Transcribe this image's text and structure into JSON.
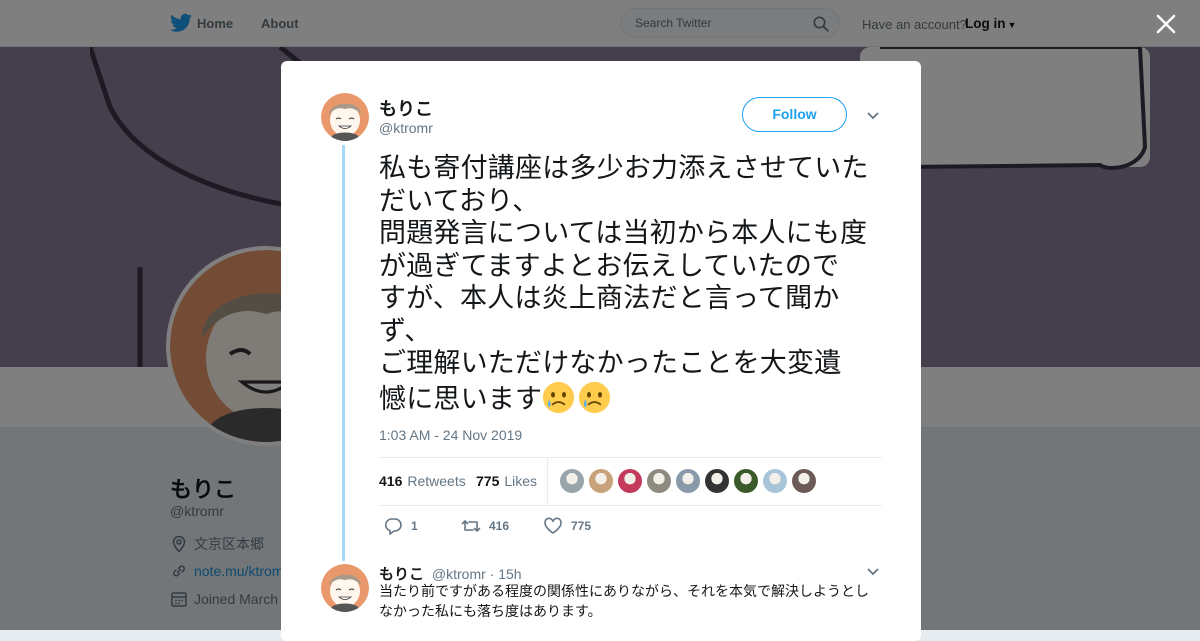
{
  "nav": {
    "home": "Home",
    "about": "About",
    "search_placeholder": "Search Twitter",
    "have_account": "Have an account?",
    "login": "Log in"
  },
  "profile": {
    "name": "もりこ",
    "handle": "@ktromr",
    "location": "文京区本郷",
    "website": "note.mu/ktrom",
    "joined": "Joined March"
  },
  "tweet": {
    "author_name": "もりこ",
    "author_handle": "@ktromr",
    "follow_label": "Follow",
    "text_lines": [
      "私も寄付講座は多少お力添えさせていた",
      "だいており、",
      "問題発言については当初から本人にも度",
      "が過ぎてますよとお伝えしていたので",
      "すが、本人は炎上商法だと言って聞か",
      "ず、",
      "ご理解いただけなかったことを大変遺",
      "憾に思います"
    ],
    "emoji": "crying-face",
    "timestamp": "1:03 AM - 24 Nov 2019",
    "retweets_count": "416",
    "retweets_label": "Retweets",
    "likes_count": "775",
    "likes_label": "Likes",
    "liker_colors": [
      "#9aa5ab",
      "#c8a27a",
      "#c33a5a",
      "#8f8a80",
      "#8899aa",
      "#333333",
      "#3a5a2a",
      "#a7c4d8",
      "#6b5a55"
    ],
    "action_counts": {
      "reply": "1",
      "retweet": "416",
      "like": "775"
    }
  },
  "reply": {
    "author_name": "もりこ",
    "author_handle": "@ktromr",
    "time": "· 15h",
    "text": "当たり前ですがある程度の関係性にありながら、それを本気で解決しようとしなかった私にも落ち度はあります。"
  },
  "colors": {
    "accent": "#1da1f2",
    "thread_line": "#a4d9f9",
    "banner": "#8b7c99"
  }
}
